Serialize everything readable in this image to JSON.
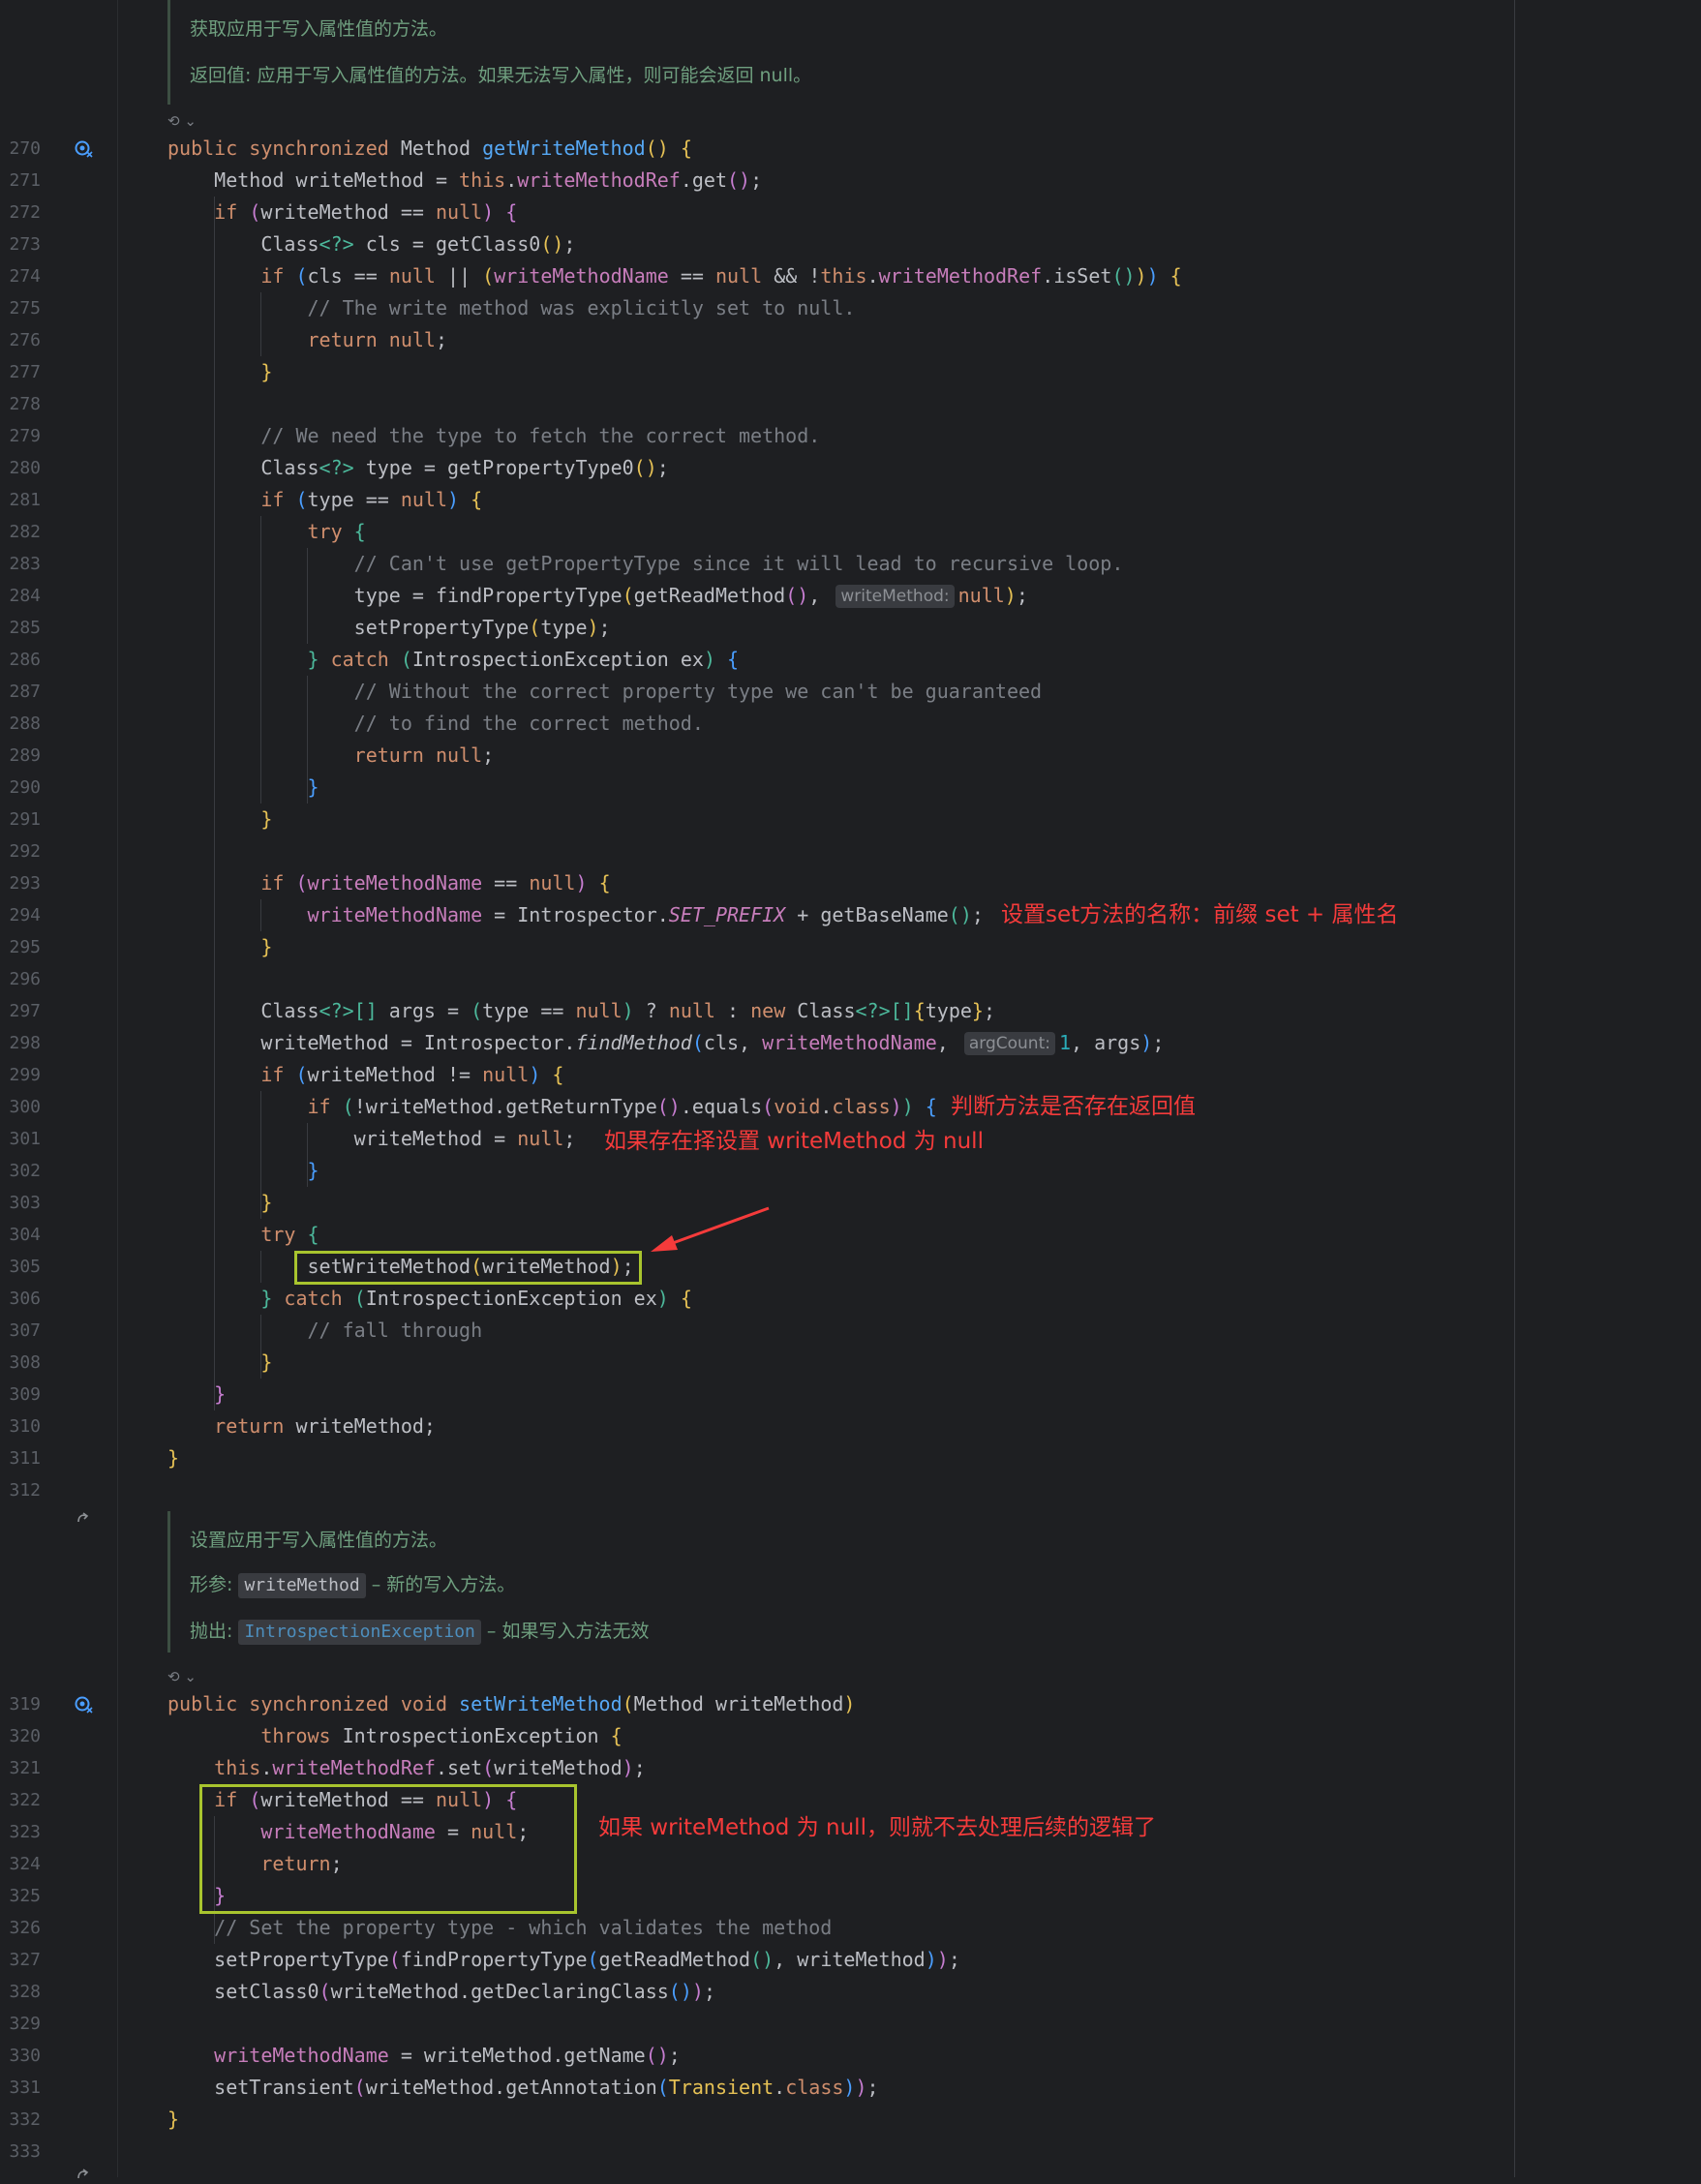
{
  "editor": {
    "doc1": {
      "summary": "获取应用于写入属性值的方法。",
      "returns": "返回值: 应用于写入属性值的方法。如果无法写入属性，则可能会返回 null。"
    },
    "doc2": {
      "summary": "设置应用于写入属性值的方法。",
      "param_label": "形参:",
      "param_name": "writeMethod",
      "param_desc": "– 新的写入方法。",
      "throws_label": "抛出:",
      "throws_name": "IntrospectionException",
      "throws_desc": "– 如果写入方法无效"
    },
    "doc_toggle_label": "⟲ ⌄",
    "line_numbers": [
      "270",
      "271",
      "272",
      "273",
      "274",
      "275",
      "276",
      "277",
      "278",
      "279",
      "280",
      "281",
      "282",
      "283",
      "284",
      "285",
      "286",
      "287",
      "288",
      "289",
      "290",
      "291",
      "292",
      "293",
      "294",
      "295",
      "296",
      "297",
      "298",
      "299",
      "300",
      "301",
      "302",
      "303",
      "304",
      "305",
      "306",
      "307",
      "308",
      "309",
      "310",
      "311",
      "312",
      "319",
      "320",
      "321",
      "322",
      "323",
      "324",
      "325",
      "326",
      "327",
      "328",
      "329",
      "330",
      "331",
      "332",
      "333"
    ],
    "inlay_hints": {
      "write_method": "writeMethod:",
      "arg_count": "argCount:"
    },
    "annotations": {
      "set_prefix": "设置set方法的名称：前缀 set + 属性名",
      "return_check": "判断方法是否存在返回值",
      "set_null": "如果存在择设置 writeMethod 为 null",
      "null_skip": "如果 writeMethod 为 null，则就不去处理后续的逻辑了"
    },
    "colors": {
      "background": "#1e1f22",
      "keyword": "#cf8e6d",
      "field": "#c77dbb",
      "method": "#56a8f5",
      "comment": "#7a7e85",
      "number": "#2aacb8",
      "annotation": "#f53b3b",
      "highlight_box": "#a8c42e"
    }
  }
}
